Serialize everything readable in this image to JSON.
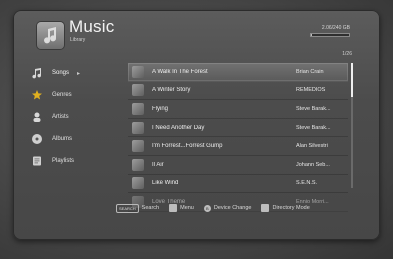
{
  "header": {
    "title": "Music",
    "subtitle": "Library",
    "storage": "2.06/240 GB",
    "storage_fraction": 0.01
  },
  "page_indicator": "1/26",
  "sidebar": {
    "items": [
      {
        "label": "Songs",
        "icon": "music-note-icon",
        "active": true
      },
      {
        "label": "Genres",
        "icon": "star-icon",
        "active": false
      },
      {
        "label": "Artists",
        "icon": "person-icon",
        "active": false
      },
      {
        "label": "Albums",
        "icon": "disc-icon",
        "active": false
      },
      {
        "label": "Playlists",
        "icon": "playlist-icon",
        "active": false
      }
    ]
  },
  "songs": [
    {
      "title": "A Walk In The Forest",
      "artist": "Brian Crain"
    },
    {
      "title": "A Winter Story",
      "artist": "REMEDIOS"
    },
    {
      "title": "Flying",
      "artist": "Steve Barak..."
    },
    {
      "title": "I Need Another Day",
      "artist": "Steve Barak..."
    },
    {
      "title": "I'm Forrest...Forrest Gump",
      "artist": "Alan Silvestri"
    },
    {
      "title": "Il Air",
      "artist": "Johann Seb..."
    },
    {
      "title": "Like Wind",
      "artist": "S.E.N.S."
    },
    {
      "title": "Love Theme",
      "artist": "Ennio Morri..."
    }
  ],
  "scroll_fraction": 0.27,
  "footer": {
    "search_key": "SEARCH",
    "search": "Search",
    "menu": "Menu",
    "device_key": "B",
    "device_change": "Device Change",
    "directory_mode": "Directory Mode"
  }
}
